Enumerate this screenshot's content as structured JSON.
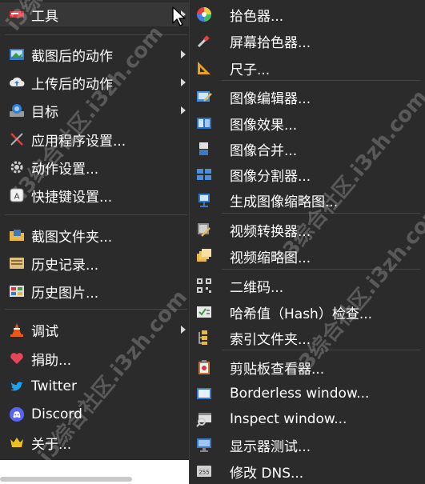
{
  "main_menu": {
    "items": [
      {
        "label": "工具",
        "icon": "tools-icon",
        "submenu": true
      },
      {
        "label": "截图后的动作",
        "icon": "after-capture-icon",
        "submenu": true
      },
      {
        "label": "上传后的动作",
        "icon": "upload-icon",
        "submenu": true
      },
      {
        "label": "目标",
        "icon": "destination-icon",
        "submenu": true
      },
      {
        "label": "应用程序设置...",
        "icon": "app-settings-icon",
        "submenu": false
      },
      {
        "label": "动作设置...",
        "icon": "gear-icon",
        "submenu": false
      },
      {
        "label": "快捷键设置...",
        "icon": "hotkey-icon",
        "submenu": false
      },
      {
        "label": "截图文件夹...",
        "icon": "folder-icon",
        "submenu": false
      },
      {
        "label": "历史记录...",
        "icon": "history-icon",
        "submenu": false
      },
      {
        "label": "历史图片...",
        "icon": "image-history-icon",
        "submenu": false
      },
      {
        "label": "调试",
        "icon": "cone-icon",
        "submenu": true
      },
      {
        "label": "捐助...",
        "icon": "heart-icon",
        "submenu": false
      },
      {
        "label": "Twitter",
        "icon": "twitter-icon",
        "submenu": false
      },
      {
        "label": "Discord",
        "icon": "discord-icon",
        "submenu": false
      },
      {
        "label": "关于...",
        "icon": "crown-icon",
        "submenu": false
      }
    ]
  },
  "tools_submenu": {
    "items": [
      {
        "label": "拾色器...",
        "icon": "color-wheel-icon"
      },
      {
        "label": "屏幕拾色器...",
        "icon": "eyedropper-icon"
      },
      {
        "label": "尺子...",
        "icon": "ruler-icon"
      },
      {
        "label": "图像编辑器...",
        "icon": "image-editor-icon"
      },
      {
        "label": "图像效果...",
        "icon": "image-effects-icon"
      },
      {
        "label": "图像合并...",
        "icon": "image-combiner-icon"
      },
      {
        "label": "图像分割器...",
        "icon": "image-splitter-icon"
      },
      {
        "label": "生成图像缩略图...",
        "icon": "thumbnailer-icon"
      },
      {
        "label": "视频转换器...",
        "icon": "video-converter-icon"
      },
      {
        "label": "视频缩略图...",
        "icon": "video-thumbnail-icon"
      },
      {
        "label": "二维码...",
        "icon": "qr-code-icon"
      },
      {
        "label": "哈希值（Hash）检查...",
        "icon": "hash-check-icon"
      },
      {
        "label": "索引文件夹...",
        "icon": "index-folder-icon"
      },
      {
        "label": "剪贴板查看器...",
        "icon": "clipboard-icon"
      },
      {
        "label": "Borderless window...",
        "icon": "borderless-window-icon"
      },
      {
        "label": "Inspect window...",
        "icon": "inspect-window-icon"
      },
      {
        "label": "显示器测试...",
        "icon": "monitor-test-icon"
      },
      {
        "label": "修改 DNS...",
        "icon": "dns-icon"
      }
    ]
  },
  "watermark": "i3综合社区.i3zh.com"
}
